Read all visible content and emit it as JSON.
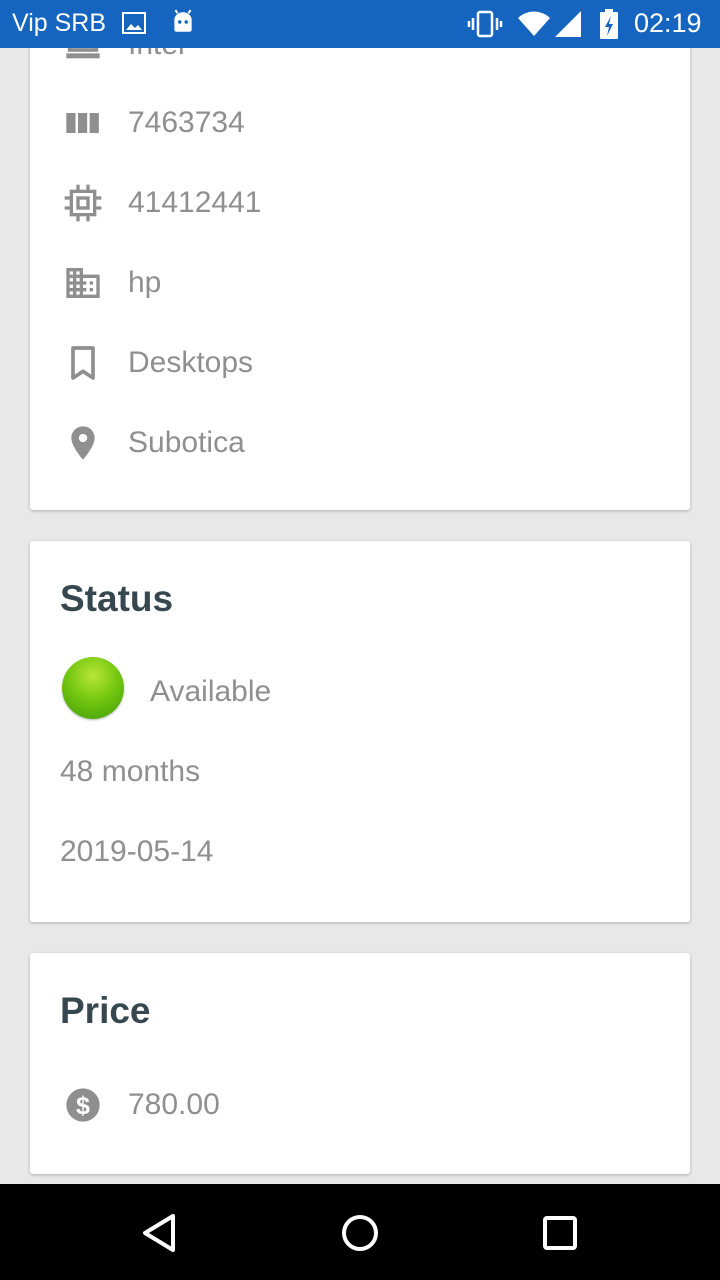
{
  "status_bar": {
    "carrier": "Vip SRB",
    "time": "02:19",
    "icons": [
      "image-icon",
      "android-icon",
      "vibrate-icon",
      "wifi-icon",
      "signal-icon",
      "battery-charging-icon"
    ]
  },
  "details": {
    "rows": [
      {
        "icon": "laptop-icon",
        "value": "Intel"
      },
      {
        "icon": "barcode-icon",
        "value": "7463734"
      },
      {
        "icon": "chip-icon",
        "value": "41412441"
      },
      {
        "icon": "building-icon",
        "value": "hp"
      },
      {
        "icon": "bookmark-icon",
        "value": "Desktops"
      },
      {
        "icon": "location-pin-icon",
        "value": "Subotica"
      }
    ]
  },
  "status": {
    "title": "Status",
    "state": "Available",
    "state_color": "#6cc20c",
    "warranty": "48 months",
    "date": "2019-05-14"
  },
  "price": {
    "title": "Price",
    "icon": "dollar-icon",
    "value": "780.00"
  },
  "nav": {
    "buttons": [
      "back-icon",
      "home-icon",
      "recents-icon"
    ]
  },
  "colors": {
    "status_bar": "#1565c0",
    "icon_gray": "#8f8f8f",
    "title": "#37474f",
    "background": "#e8e8e8"
  }
}
